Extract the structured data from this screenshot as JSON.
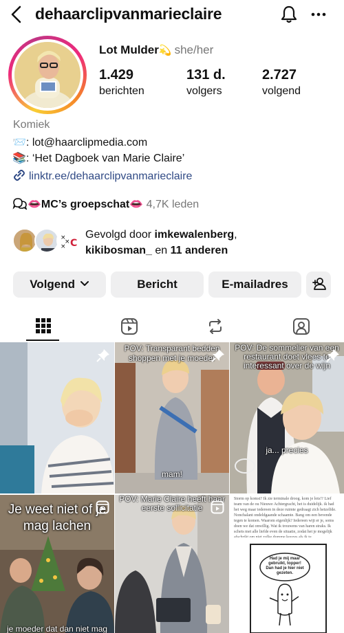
{
  "header": {
    "handle": "dehaarclipvanmarieclaire",
    "back_icon": "chevron-left-icon",
    "bell_icon": "bell-icon",
    "more_icon": "more-horizontal-icon"
  },
  "profile": {
    "display_name": "Lot Mulder",
    "name_emoji": "💫",
    "pronouns": "she/her",
    "stats": [
      {
        "value": "1.429",
        "label": "berichten"
      },
      {
        "value": "131 d.",
        "label": "volgers"
      },
      {
        "value": "2.727",
        "label": "volgend"
      }
    ],
    "category": "Komiek",
    "bio_lines": [
      {
        "emoji": "📨",
        "text": ": lot@haarclipmedia.com"
      },
      {
        "emoji": "📚",
        "text": ": ‘Het Dagboek van Marie Claire’"
      }
    ],
    "link": "linktr.ee/dehaarclipvanmarieclaire",
    "group_chat": {
      "emoji": "👄",
      "name": "MC’s groepschat",
      "members": "4,7K leden"
    },
    "followed_by": {
      "prefix": "Gevolgd door ",
      "user1": "imkewalenberg",
      "sep": ",",
      "user2": "kikibosman_",
      "middle": " en ",
      "others": "11 anderen"
    }
  },
  "actions": {
    "follow": "Volgend",
    "message": "Bericht",
    "email": "E-mailadres"
  },
  "tabs": [
    "grid-icon",
    "reels-icon",
    "reposts-icon",
    "tagged-icon"
  ],
  "posts": [
    {
      "caption": "",
      "pinned": true
    },
    {
      "caption": "POV: Transparant bedden shoppen met je moeder",
      "overlay": "mam!",
      "pinned": true
    },
    {
      "caption": "POV: De sommelier van een restaurant doet vlees te interessant over de wijn",
      "overlay": "ja... precies",
      "pinned": true
    },
    {
      "caption": "Je weet niet of je mag lachen",
      "bottom": "je moeder dat dan niet mag",
      "reel": true
    },
    {
      "caption": "POV: Marie Claire heeft haar eerste sollicitatie",
      "reel": true
    },
    {
      "text": "Storm op komst? Ik zie terminale droog. kom je lots!? Lief team van de ou Nieuwe Achtergracht, het is duidelijk. ik had het weg maar iedereen in deze ruimte gedraagt zich hetzelfde. Nonchalant ondeldgaande schaamte. Bang om een bevende tegen te komen. Waarom eigenlijk? Iedereen wijt er je, soms doen we dat onwillig. Wat ik trouwens van haren straks. Ik schets met alle liefde even de situatie, zodat het je mogelijk afschrikt om niet zulke domme keuzes als ik te",
      "bubble": "Had je mij maar gebruikt, topper! Dan had je hier niet gezeten."
    }
  ],
  "colors": {
    "link": "#304a85",
    "muted": "#777777",
    "button_bg": "#efeff0"
  }
}
